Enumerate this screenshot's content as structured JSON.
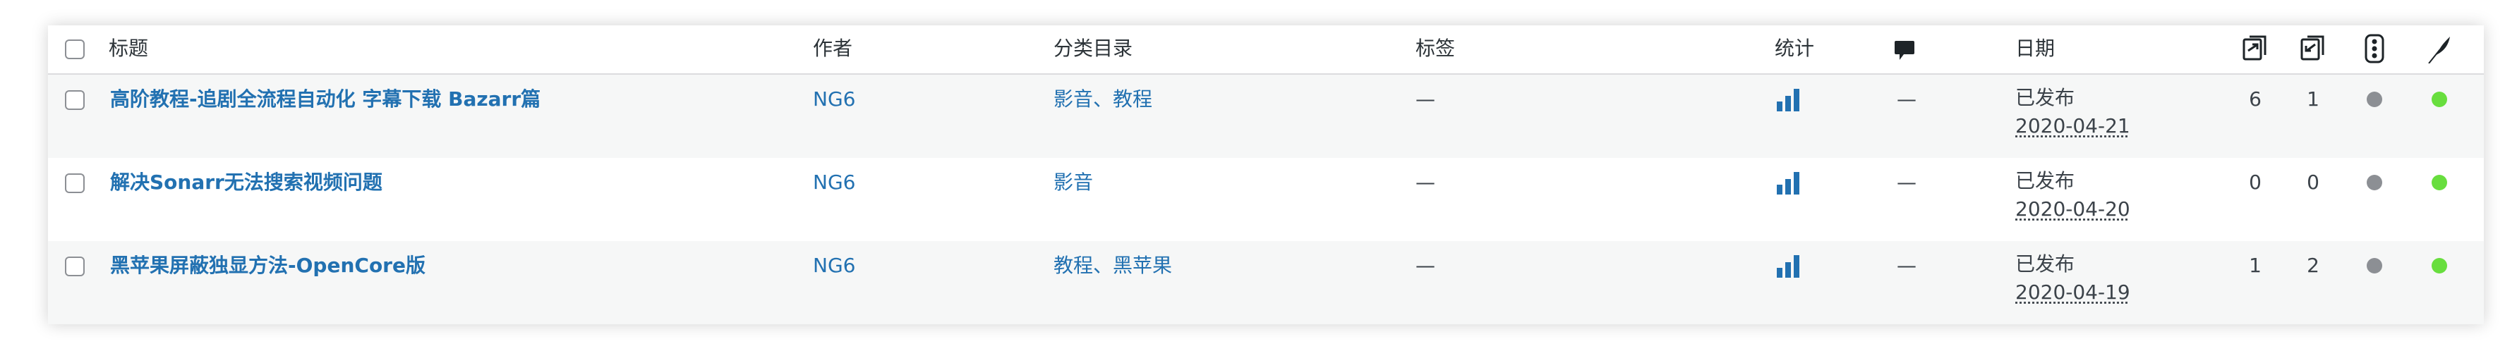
{
  "header": {
    "title": "标题",
    "author": "作者",
    "categories": "分类目录",
    "tags": "标签",
    "stats": "统计",
    "date": "日期"
  },
  "rows": [
    {
      "title": "高阶教程-追剧全流程自动化 字幕下载 Bazarr篇",
      "author": "NG6",
      "categories": "影音、教程",
      "tags": "—",
      "comments": "—",
      "status": "已发布",
      "date": "2020-04-21",
      "count1": "6",
      "count2": "1"
    },
    {
      "title": "解决Sonarr无法搜索视频问题",
      "author": "NG6",
      "categories": "影音",
      "tags": "—",
      "comments": "—",
      "status": "已发布",
      "date": "2020-04-20",
      "count1": "0",
      "count2": "0"
    },
    {
      "title": "黑苹果屏蔽独显方法-OpenCore版",
      "author": "NG6",
      "categories": "教程、黑苹果",
      "tags": "—",
      "comments": "—",
      "status": "已发布",
      "date": "2020-04-19",
      "count1": "1",
      "count2": "2"
    }
  ],
  "colors": {
    "link": "#2271b1",
    "status_gray": "#8c8f94",
    "status_green": "#68de3e"
  },
  "icons": {
    "stats": "bar-chart-icon",
    "comments": "comment-bubble-icon",
    "col1": "outgoing-links-icon",
    "col2": "incoming-links-icon",
    "col3": "traffic-light-icon",
    "col4": "feather-icon"
  }
}
